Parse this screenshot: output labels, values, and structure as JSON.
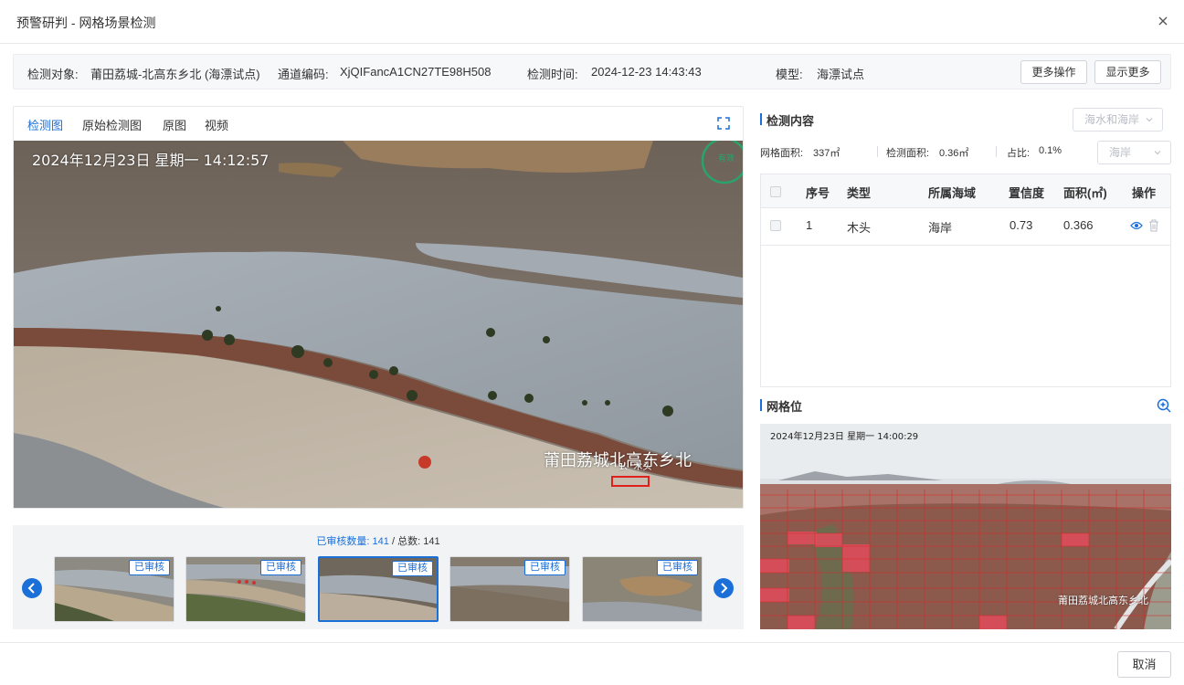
{
  "modal": {
    "title": "预警研判 - 网格场景检测"
  },
  "info": {
    "object_label": "检测对象:",
    "object_value": "莆田荔城-北高东乡北 (海漂试点)",
    "channel_label": "通道编码:",
    "channel_value": "XjQIFancA1CN27TE98H508",
    "time_label": "检测时间:",
    "time_value": "2024-12-23 14:43:43",
    "model_label": "模型:",
    "model_value": "海漂试点",
    "more_ops_label": "更多操作",
    "show_more_label": "显示更多"
  },
  "tabs": [
    {
      "label": "检测图",
      "active": true
    },
    {
      "label": "原始检测图",
      "active": false
    },
    {
      "label": "原图",
      "active": false
    },
    {
      "label": "视频",
      "active": false
    }
  ],
  "main_image": {
    "timestamp": "2024年12月23日  星期一  14:12:57",
    "location_watermark": "莆田荔城北高东乡北",
    "detection_label": "1、木头",
    "stamp_text": "有效"
  },
  "strip": {
    "reviewed_label": "已审核数量:",
    "reviewed_count": "141",
    "total_label": " / 总数:",
    "total_count": "141",
    "thumbnails": [
      {
        "badge": "已审核",
        "selected": false
      },
      {
        "badge": "已审核",
        "selected": false
      },
      {
        "badge": "已审核",
        "selected": true
      },
      {
        "badge": "已审核",
        "selected": false
      },
      {
        "badge": "已审核",
        "selected": false
      }
    ]
  },
  "detect": {
    "title": "检测内容",
    "category_select": "海水和海岸",
    "area_label": "网格面积:",
    "area_value": "337㎡",
    "detected_area_label": "检测面积:",
    "detected_area_value": "0.36㎡",
    "ratio_label": "占比:",
    "ratio_value": "0.1%",
    "region_select": "海岸"
  },
  "table": {
    "headers": [
      "序号",
      "类型",
      "所属海域",
      "置信度",
      "面积(㎡)",
      "操作"
    ],
    "rows": [
      {
        "index": "1",
        "type": "木头",
        "sea_area": "海岸",
        "confidence": "0.73",
        "area": "0.366"
      }
    ]
  },
  "grid": {
    "title": "网格位",
    "timestamp": "2024年12月23日  星期一  14:00:29",
    "watermark": "莆田荔城北高东乡北"
  },
  "footer": {
    "cancel_label": "取消"
  },
  "colors": {
    "accent": "#1a6fd8",
    "detection_box": "#e0201c",
    "grid_line": "#d42a2a"
  }
}
